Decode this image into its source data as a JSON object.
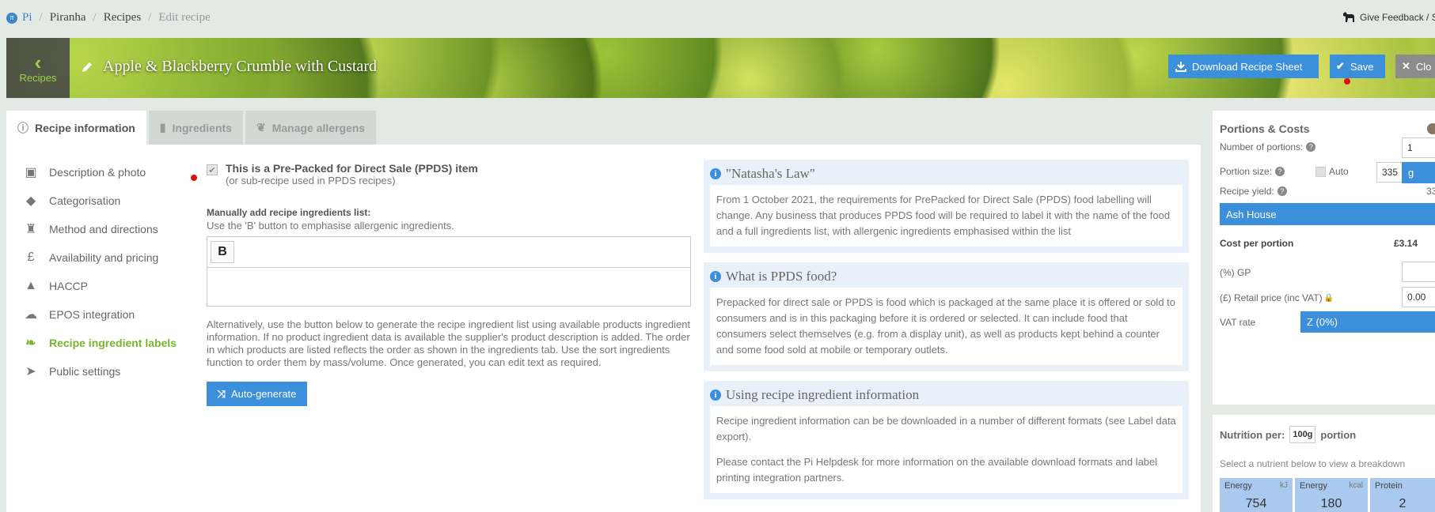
{
  "breadcrumb": {
    "root": "Pi",
    "org": "Piranha",
    "section": "Recipes",
    "current": "Edit recipe"
  },
  "feedback_label": "Give Feedback / S",
  "header": {
    "back_label": "Recipes",
    "recipe_title": "Apple & Blackberry Crumble with Custard",
    "download_label": "Download Recipe Sheet",
    "save_label": "Save",
    "close_label": "Clo"
  },
  "tabs": [
    {
      "label": "Recipe information",
      "icon": "info-icon"
    },
    {
      "label": "Ingredients",
      "icon": "jar-icon"
    },
    {
      "label": "Manage allergens",
      "icon": "allergen-icon"
    }
  ],
  "sidenav": [
    {
      "label": "Description & photo",
      "icon": "image-icon"
    },
    {
      "label": "Categorisation",
      "icon": "tags-icon"
    },
    {
      "label": "Method and directions",
      "icon": "mixer-icon"
    },
    {
      "label": "Availability and pricing",
      "icon": "pound-icon"
    },
    {
      "label": "HACCP",
      "icon": "warning-icon"
    },
    {
      "label": "EPOS integration",
      "icon": "cloud-upload-icon"
    },
    {
      "label": "Recipe ingredient labels",
      "icon": "leaf-icon"
    },
    {
      "label": "Public settings",
      "icon": "paper-plane-icon"
    }
  ],
  "ppds": {
    "title": "This is a Pre-Packed for Direct Sale (PPDS) item",
    "subtitle": "(or sub-recipe used in PPDS recipes)",
    "checked": true,
    "manual_label": "Manually add recipe ingredients list:",
    "manual_help": "Use the 'B' button to emphasise allergenic ingredients.",
    "bold_button": "B",
    "alt_text": "Alternatively, use the button below to generate the recipe ingredient list using available products ingredient information. If no product ingredient data is available the supplier's product description is added. The order in which products are listed reflects the order as shown in the ingredients tab. Use the sort ingredients function to order them by mass/volume. Once generated, you can edit text as required.",
    "auto_generate_label": "Auto-generate"
  },
  "info_boxes": [
    {
      "title": "\"Natasha's Law\"",
      "paragraphs": [
        "From 1 October 2021, the requirements for PrePacked for Direct Sale (PPDS) food labelling will change. Any business that produces PPDS food will be required to label it with the name of the food and a full ingredients list, with allergenic ingredients emphasised within the list"
      ]
    },
    {
      "title": "What is PPDS food?",
      "paragraphs": [
        "Prepacked for direct sale or PPDS is food which is packaged at the same place it is offered or sold to consumers and is in this packaging before it is ordered or selected. It can include food that consumers select themselves (e.g. from a display unit), as well as products kept behind a counter and some food sold at mobile or temporary outlets."
      ]
    },
    {
      "title": "Using recipe ingredient information",
      "paragraphs": [
        "Recipe ingredient information can be be downloaded in a number of different formats (see Label data export).",
        "Please contact the Pi Helpdesk for more information on the available download formats and label printing integration partners."
      ]
    }
  ],
  "portions": {
    "title": "Portions & Costs",
    "num_portions_label": "Number of portions:",
    "num_portions_value": "1",
    "portion_size_label": "Portion size:",
    "auto_label": "Auto",
    "portion_size_value": "335",
    "unit": "g",
    "yield_label": "Recipe yield:",
    "yield_value": "33",
    "site": "Ash House",
    "cost_label": "Cost per portion",
    "cost_value": "£3.14",
    "gp_label": "(%) GP",
    "gp_value": "",
    "retail_label": "(£) Retail price (inc VAT)",
    "retail_value": "0.00",
    "vat_label": "VAT rate",
    "vat_value": "Z (0%)"
  },
  "nutrition": {
    "title_prefix": "Nutrition per:",
    "amount": "100g",
    "title_suffix": "portion",
    "help": "Select a nutrient below to view a breakdown",
    "tiles": [
      {
        "label": "Energy",
        "unit": "kJ",
        "value": "754"
      },
      {
        "label": "Energy",
        "unit": "kcal",
        "value": "180"
      },
      {
        "label": "Protein",
        "unit": "",
        "value": "2"
      }
    ]
  }
}
